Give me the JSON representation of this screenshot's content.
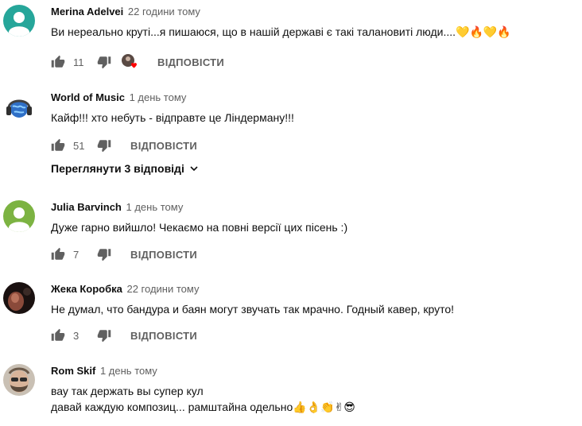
{
  "comments": [
    {
      "author": "Merina Adelvei",
      "time": "22 години тому",
      "text": "Ви нереально круті...я пишаюся, що в нашій державі є такі талановиті люди....💛🔥💛🔥",
      "likes": "11",
      "reply_label": "ВІДПОВІСТИ",
      "avatar_color": "#26a69a"
    },
    {
      "author": "World of Music",
      "time": "1 день тому",
      "text": "Кайф!!! хто небуть - відправте це Ліндерману!!!",
      "likes": "51",
      "reply_label": "ВІДПОВІСТИ",
      "view_replies": "Переглянути 3 відповіді"
    },
    {
      "author": "Julia Barvinch",
      "time": "1 день тому",
      "text": "Дуже гарно вийшло! Чекаємо на повні версії цих пісень :)",
      "likes": "7",
      "reply_label": "ВІДПОВІСТИ",
      "avatar_color": "#7cb342"
    },
    {
      "author": "Жека Коробка",
      "time": "22 години тому",
      "text": "Не думал, что бандура и баян могут звучать так мрачно. Годный кавер, круто!",
      "likes": "3",
      "reply_label": "ВІДПОВІСТИ"
    },
    {
      "author": "Rom Skif",
      "time": "1 день тому",
      "text": "вау так держать вы супер кул\nдавай каждую композиц... рамштайна одельно👍👌👏✌😎"
    }
  ],
  "colors": {
    "text_primary": "#0f0f0f",
    "text_secondary": "#606060",
    "icon": "#606060",
    "heart": "#ff0000"
  }
}
